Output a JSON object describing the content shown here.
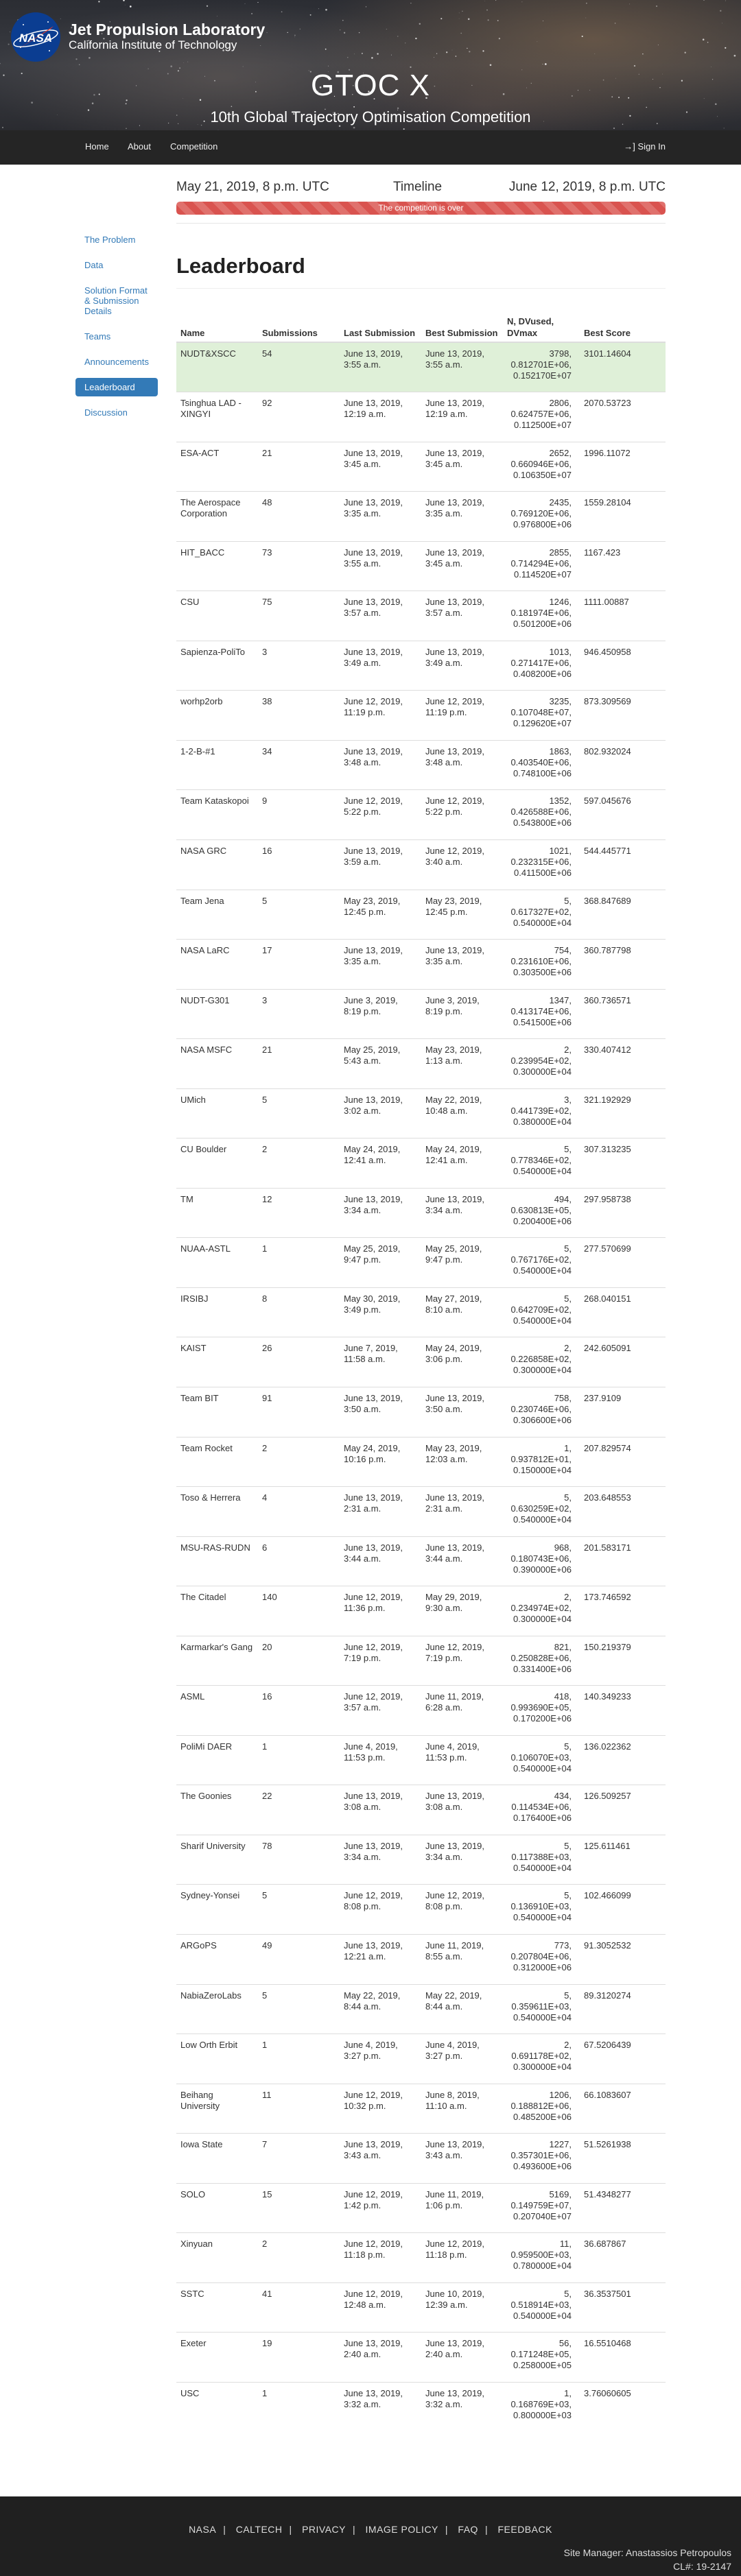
{
  "header": {
    "org_title": "Jet Propulsion Laboratory",
    "org_subtitle": "California Institute of Technology",
    "logo_text": "NASA",
    "site_title": "GTOC X",
    "site_subtitle": "10th Global Trajectory Optimisation Competition"
  },
  "nav": {
    "home": "Home",
    "about": "About",
    "competition": "Competition",
    "sign_in": "Sign In"
  },
  "timeline": {
    "start": "May 21, 2019, 8 p.m. UTC",
    "label": "Timeline",
    "end": "June 12, 2019, 8 p.m. UTC",
    "status": "The competition is over",
    "progress_percent": 100
  },
  "sidebar": {
    "items": [
      {
        "label": "The Problem"
      },
      {
        "label": "Data"
      },
      {
        "label": "Solution Format & Submission Details"
      },
      {
        "label": "Teams"
      },
      {
        "label": "Announcements"
      },
      {
        "label": "Leaderboard"
      },
      {
        "label": "Discussion"
      }
    ]
  },
  "leaderboard": {
    "title": "Leaderboard",
    "columns": [
      "Name",
      "Submissions",
      "Last Submission",
      "Best Submission",
      "N, DVused, DVmax",
      "Best Score"
    ],
    "rows": [
      [
        "NUDT&XSCC",
        "54",
        "June 13, 2019, 3:55 a.m.",
        "June 13, 2019, 3:55 a.m.",
        "3798, 0.812701E+06, 0.152170E+07",
        "3101.14604"
      ],
      [
        "Tsinghua LAD - XINGYI",
        "92",
        "June 13, 2019, 12:19 a.m.",
        "June 13, 2019, 12:19 a.m.",
        "2806, 0.624757E+06, 0.112500E+07",
        "2070.53723"
      ],
      [
        "ESA-ACT",
        "21",
        "June 13, 2019, 3:45 a.m.",
        "June 13, 2019, 3:45 a.m.",
        "2652, 0.660946E+06, 0.106350E+07",
        "1996.11072"
      ],
      [
        "The Aerospace Corporation",
        "48",
        "June 13, 2019, 3:35 a.m.",
        "June 13, 2019, 3:35 a.m.",
        "2435, 0.769120E+06, 0.976800E+06",
        "1559.28104"
      ],
      [
        "HIT_BACC",
        "73",
        "June 13, 2019, 3:55 a.m.",
        "June 13, 2019, 3:45 a.m.",
        "2855, 0.714294E+06, 0.114520E+07",
        "1167.423"
      ],
      [
        "CSU",
        "75",
        "June 13, 2019, 3:57 a.m.",
        "June 13, 2019, 3:57 a.m.",
        "1246, 0.181974E+06, 0.501200E+06",
        "1111.00887"
      ],
      [
        "Sapienza-PoliTo",
        "3",
        "June 13, 2019, 3:49 a.m.",
        "June 13, 2019, 3:49 a.m.",
        "1013, 0.271417E+06, 0.408200E+06",
        "946.450958"
      ],
      [
        "worhp2orb",
        "38",
        "June 12, 2019, 11:19 p.m.",
        "June 12, 2019, 11:19 p.m.",
        "3235, 0.107048E+07, 0.129620E+07",
        "873.309569"
      ],
      [
        "1-2-B-#1",
        "34",
        "June 13, 2019, 3:48 a.m.",
        "June 13, 2019, 3:48 a.m.",
        "1863, 0.403540E+06, 0.748100E+06",
        "802.932024"
      ],
      [
        "Team Kataskopoi",
        "9",
        "June 12, 2019, 5:22 p.m.",
        "June 12, 2019, 5:22 p.m.",
        "1352, 0.426588E+06, 0.543800E+06",
        "597.045676"
      ],
      [
        "NASA GRC",
        "16",
        "June 13, 2019, 3:59 a.m.",
        "June 12, 2019, 3:40 a.m.",
        "1021, 0.232315E+06, 0.411500E+06",
        "544.445771"
      ],
      [
        "Team Jena",
        "5",
        "May 23, 2019, 12:45 p.m.",
        "May 23, 2019, 12:45 p.m.",
        "5, 0.617327E+02, 0.540000E+04",
        "368.847689"
      ],
      [
        "NASA LaRC",
        "17",
        "June 13, 2019, 3:35 a.m.",
        "June 13, 2019, 3:35 a.m.",
        "754, 0.231610E+06, 0.303500E+06",
        "360.787798"
      ],
      [
        "NUDT-G301",
        "3",
        "June 3, 2019, 8:19 p.m.",
        "June 3, 2019, 8:19 p.m.",
        "1347, 0.413174E+06, 0.541500E+06",
        "360.736571"
      ],
      [
        "NASA MSFC",
        "21",
        "May 25, 2019, 5:43 a.m.",
        "May 23, 2019, 1:13 a.m.",
        "2, 0.239954E+02, 0.300000E+04",
        "330.407412"
      ],
      [
        "UMich",
        "5",
        "June 13, 2019, 3:02 a.m.",
        "May 22, 2019, 10:48 a.m.",
        "3, 0.441739E+02, 0.380000E+04",
        "321.192929"
      ],
      [
        "CU Boulder",
        "2",
        "May 24, 2019, 12:41 a.m.",
        "May 24, 2019, 12:41 a.m.",
        "5, 0.778346E+02, 0.540000E+04",
        "307.313235"
      ],
      [
        "TM",
        "12",
        "June 13, 2019, 3:34 a.m.",
        "June 13, 2019, 3:34 a.m.",
        "494, 0.630813E+05, 0.200400E+06",
        "297.958738"
      ],
      [
        "NUAA-ASTL",
        "1",
        "May 25, 2019, 9:47 p.m.",
        "May 25, 2019, 9:47 p.m.",
        "5, 0.767176E+02, 0.540000E+04",
        "277.570699"
      ],
      [
        "IRSIBJ",
        "8",
        "May 30, 2019, 3:49 p.m.",
        "May 27, 2019, 8:10 a.m.",
        "5, 0.642709E+02, 0.540000E+04",
        "268.040151"
      ],
      [
        "KAIST",
        "26",
        "June 7, 2019, 11:58 a.m.",
        "May 24, 2019, 3:06 p.m.",
        "2, 0.226858E+02, 0.300000E+04",
        "242.605091"
      ],
      [
        "Team BIT",
        "91",
        "June 13, 2019, 3:50 a.m.",
        "June 13, 2019, 3:50 a.m.",
        "758, 0.230746E+06, 0.306600E+06",
        "237.9109"
      ],
      [
        "Team Rocket",
        "2",
        "May 24, 2019, 10:16 p.m.",
        "May 23, 2019, 12:03 a.m.",
        "1, 0.937812E+01, 0.150000E+04",
        "207.829574"
      ],
      [
        "Toso & Herrera",
        "4",
        "June 13, 2019, 2:31 a.m.",
        "June 13, 2019, 2:31 a.m.",
        "5, 0.630259E+02, 0.540000E+04",
        "203.648553"
      ],
      [
        "MSU-RAS-RUDN",
        "6",
        "June 13, 2019, 3:44 a.m.",
        "June 13, 2019, 3:44 a.m.",
        "968, 0.180743E+06, 0.390000E+06",
        "201.583171"
      ],
      [
        "The Citadel",
        "140",
        "June 12, 2019, 11:36 p.m.",
        "May 29, 2019, 9:30 a.m.",
        "2, 0.234974E+02, 0.300000E+04",
        "173.746592"
      ],
      [
        "Karmarkar's Gang",
        "20",
        "June 12, 2019, 7:19 p.m.",
        "June 12, 2019, 7:19 p.m.",
        "821, 0.250828E+06, 0.331400E+06",
        "150.219379"
      ],
      [
        "ASML",
        "16",
        "June 12, 2019, 3:57 a.m.",
        "June 11, 2019, 6:28 a.m.",
        "418, 0.993690E+05, 0.170200E+06",
        "140.349233"
      ],
      [
        "PoliMi DAER",
        "1",
        "June 4, 2019, 11:53 p.m.",
        "June 4, 2019, 11:53 p.m.",
        "5, 0.106070E+03, 0.540000E+04",
        "136.022362"
      ],
      [
        "The Goonies",
        "22",
        "June 13, 2019, 3:08 a.m.",
        "June 13, 2019, 3:08 a.m.",
        "434, 0.114534E+06, 0.176400E+06",
        "126.509257"
      ],
      [
        "Sharif University",
        "78",
        "June 13, 2019, 3:34 a.m.",
        "June 13, 2019, 3:34 a.m.",
        "5, 0.117388E+03, 0.540000E+04",
        "125.611461"
      ],
      [
        "Sydney-Yonsei",
        "5",
        "June 12, 2019, 8:08 p.m.",
        "June 12, 2019, 8:08 p.m.",
        "5, 0.136910E+03, 0.540000E+04",
        "102.466099"
      ],
      [
        "ARGoPS",
        "49",
        "June 13, 2019, 12:21 a.m.",
        "June 11, 2019, 8:55 a.m.",
        "773, 0.207804E+06, 0.312000E+06",
        "91.3052532"
      ],
      [
        "NabiaZeroLabs",
        "5",
        "May 22, 2019, 8:44 a.m.",
        "May 22, 2019, 8:44 a.m.",
        "5, 0.359611E+03, 0.540000E+04",
        "89.3120274"
      ],
      [
        "Low Orth Erbit",
        "1",
        "June 4, 2019, 3:27 p.m.",
        "June 4, 2019, 3:27 p.m.",
        "2, 0.691178E+02, 0.300000E+04",
        "67.5206439"
      ],
      [
        "Beihang University",
        "11",
        "June 12, 2019, 10:32 p.m.",
        "June 8, 2019, 11:10 a.m.",
        "1206, 0.188812E+06, 0.485200E+06",
        "66.1083607"
      ],
      [
        "Iowa State",
        "7",
        "June 13, 2019, 3:43 a.m.",
        "June 13, 2019, 3:43 a.m.",
        "1227, 0.357301E+06, 0.493600E+06",
        "51.5261938"
      ],
      [
        "SOLO",
        "15",
        "June 12, 2019, 1:42 p.m.",
        "June 11, 2019, 1:06 p.m.",
        "5169, 0.149759E+07, 0.207040E+07",
        "51.4348277"
      ],
      [
        "Xinyuan",
        "2",
        "June 12, 2019, 11:18 p.m.",
        "June 12, 2019, 11:18 p.m.",
        "11, 0.959500E+03, 0.780000E+04",
        "36.687867"
      ],
      [
        "SSTC",
        "41",
        "June 12, 2019, 12:48 a.m.",
        "June 10, 2019, 12:39 a.m.",
        "5, 0.518914E+03, 0.540000E+04",
        "36.3537501"
      ],
      [
        "Exeter",
        "19",
        "June 13, 2019, 2:40 a.m.",
        "June 13, 2019, 2:40 a.m.",
        "56, 0.171248E+05, 0.258000E+05",
        "16.5510468"
      ],
      [
        "USC",
        "1",
        "June 13, 2019, 3:32 a.m.",
        "June 13, 2019, 3:32 a.m.",
        "1, 0.168769E+03, 0.800000E+03",
        "3.76060605"
      ]
    ]
  },
  "footer": {
    "links": [
      "NASA",
      "CALTECH",
      "PRIVACY",
      "IMAGE POLICY",
      "FAQ",
      "FEEDBACK"
    ],
    "separator": "|",
    "site_manager": "Site Manager: Anastassios Petropoulos",
    "cl_number": "CL#: 19-2147"
  },
  "colors": {
    "accent": "#337ab7",
    "winner_row": "#dff0d8",
    "progress": "#d9534f",
    "navbar": "#252525",
    "footer": "#202020"
  }
}
